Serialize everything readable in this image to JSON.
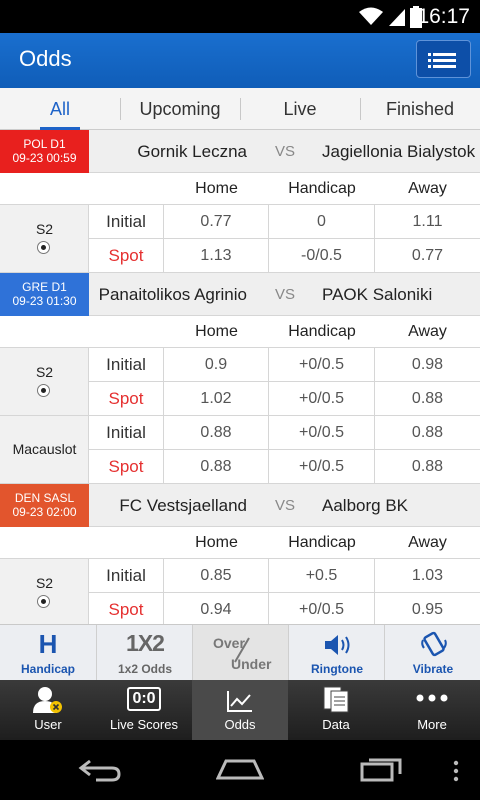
{
  "status_bar": {
    "time": "16:17"
  },
  "app_bar": {
    "title": "Odds"
  },
  "tabs": [
    {
      "label": "All",
      "active": true
    },
    {
      "label": "Upcoming",
      "active": false
    },
    {
      "label": "Live",
      "active": false
    },
    {
      "label": "Finished",
      "active": false
    }
  ],
  "columns": {
    "home": "Home",
    "handicap": "Handicap",
    "away": "Away"
  },
  "row_labels": {
    "initial": "Initial",
    "spot": "Spot"
  },
  "matches": [
    {
      "league": "POL D1",
      "datetime": "09-23 00:59",
      "league_color": "#e8201e",
      "home": "Gornik Leczna",
      "vs": "VS",
      "away": "Jagiellonia Bialystok",
      "bookmakers": [
        {
          "name": "S2",
          "ball": true,
          "initial": {
            "home": "0.77",
            "handicap": "0",
            "away": "1.11"
          },
          "spot": {
            "home": "1.13",
            "handicap": "-0/0.5",
            "away": "0.77"
          }
        }
      ]
    },
    {
      "league": "GRE D1",
      "datetime": "09-23 01:30",
      "league_color": "#2f72d8",
      "home": "Panaitolikos Agrinio",
      "vs": "VS",
      "away": "PAOK Saloniki",
      "bookmakers": [
        {
          "name": "S2",
          "ball": true,
          "initial": {
            "home": "0.9",
            "handicap": "+0/0.5",
            "away": "0.98"
          },
          "spot": {
            "home": "1.02",
            "handicap": "+0/0.5",
            "away": "0.88"
          }
        },
        {
          "name": "Macauslot",
          "ball": false,
          "initial": {
            "home": "0.88",
            "handicap": "+0/0.5",
            "away": "0.88"
          },
          "spot": {
            "home": "0.88",
            "handicap": "+0/0.5",
            "away": "0.88"
          }
        }
      ]
    },
    {
      "league": "DEN SASL",
      "datetime": "09-23 02:00",
      "league_color": "#e2552d",
      "home": "FC Vestsjaelland",
      "vs": "VS",
      "away": "Aalborg BK",
      "bookmakers": [
        {
          "name": "S2",
          "ball": true,
          "initial": {
            "home": "0.85",
            "handicap": "+0.5",
            "away": "1.03"
          },
          "spot": {
            "home": "0.94",
            "handicap": "+0/0.5",
            "away": "0.95"
          }
        }
      ]
    }
  ],
  "filter_bar": [
    {
      "id": "handicap",
      "label": "Handicap",
      "icon": "handicap-h-icon",
      "glyph": "H"
    },
    {
      "id": "1x2",
      "label": "1x2 Odds",
      "icon": "1x2-icon",
      "glyph": "1X2"
    },
    {
      "id": "overunder",
      "label": "",
      "icon": "over-under-icon",
      "glyph_top": "Over",
      "glyph_bottom": "Under"
    },
    {
      "id": "ringtone",
      "label": "Ringtone",
      "icon": "speaker-icon"
    },
    {
      "id": "vibrate",
      "label": "Vibrate",
      "icon": "vibrate-phone-icon"
    }
  ],
  "bottom_nav": [
    {
      "id": "user",
      "label": "User",
      "icon": "user-icon",
      "active": false
    },
    {
      "id": "livescores",
      "label": "Live Scores",
      "icon": "scoreboard-icon",
      "glyph": "0:0",
      "active": false
    },
    {
      "id": "odds",
      "label": "Odds",
      "icon": "line-chart-icon",
      "active": true
    },
    {
      "id": "data",
      "label": "Data",
      "icon": "documents-icon",
      "active": false
    },
    {
      "id": "more",
      "label": "More",
      "icon": "more-dots-icon",
      "active": false
    }
  ],
  "colors": {
    "accent": "#1565c0",
    "spot": "#e53030",
    "active_tab": "#1e63c8"
  }
}
